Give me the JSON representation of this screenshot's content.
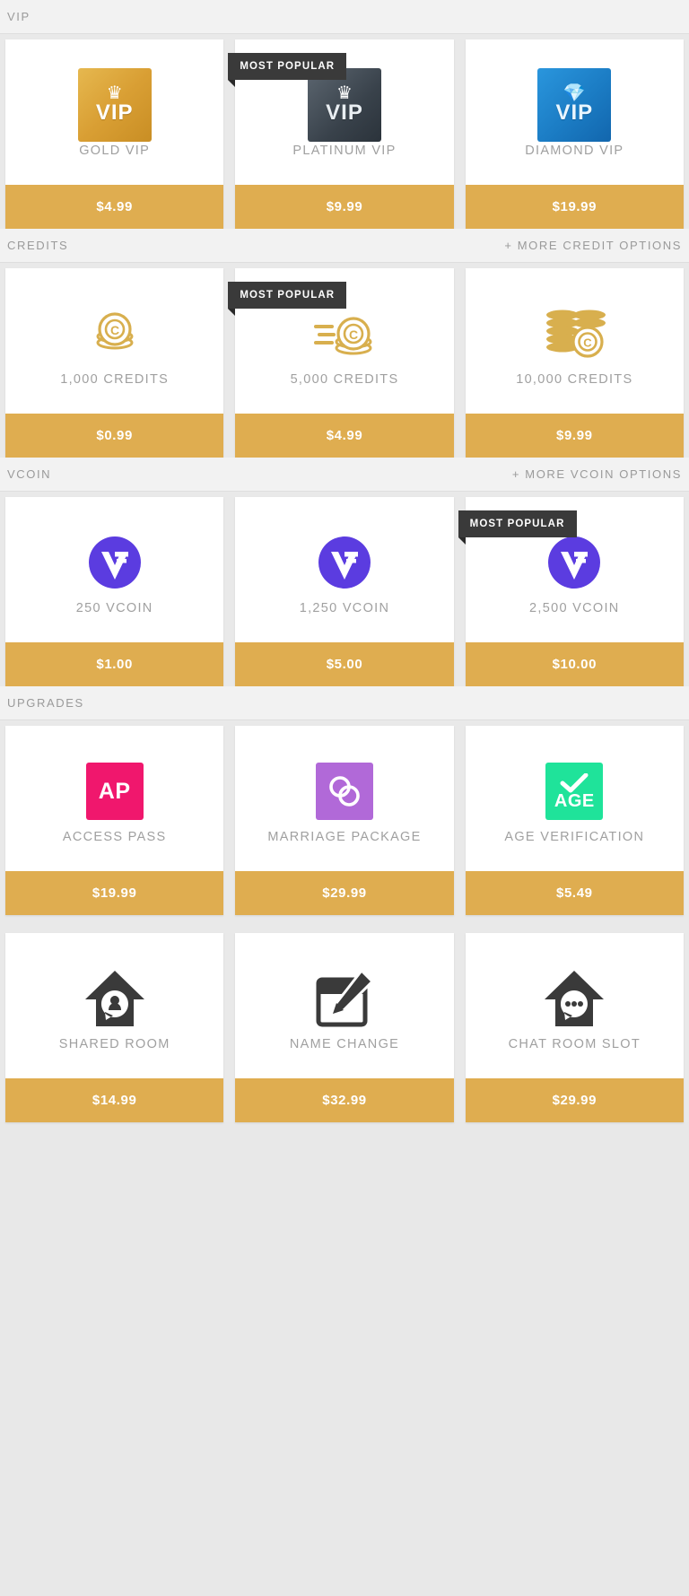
{
  "sections": [
    {
      "id": "vip",
      "title": "VIP",
      "more_label": "",
      "cards": [
        {
          "icon": "vip-gold-tile-icon",
          "label": "GOLD VIP",
          "price": "$4.99",
          "badge": ""
        },
        {
          "icon": "vip-platinum-tile-icon",
          "label": "PLATINUM VIP",
          "price": "$9.99",
          "badge": "MOST POPULAR"
        },
        {
          "icon": "vip-diamond-tile-icon",
          "label": "DIAMOND VIP",
          "price": "$19.99",
          "badge": ""
        }
      ]
    },
    {
      "id": "credits",
      "title": "CREDITS",
      "more_label": "+ MORE CREDIT OPTIONS",
      "cards": [
        {
          "icon": "single-coin-icon",
          "label": "1,000 CREDITS",
          "price": "$0.99",
          "badge": ""
        },
        {
          "icon": "flying-coin-icon",
          "label": "5,000 CREDITS",
          "price": "$4.99",
          "badge": "MOST POPULAR"
        },
        {
          "icon": "coin-stack-icon",
          "label": "10,000 CREDITS",
          "price": "$9.99",
          "badge": ""
        }
      ]
    },
    {
      "id": "vcoin",
      "title": "VCOIN",
      "more_label": "+ MORE VCOIN OPTIONS",
      "cards": [
        {
          "icon": "vcoin-icon",
          "label": "250 VCOIN",
          "price": "$1.00",
          "badge": ""
        },
        {
          "icon": "vcoin-icon",
          "label": "1,250 VCOIN",
          "price": "$5.00",
          "badge": ""
        },
        {
          "icon": "vcoin-icon",
          "label": "2,500 VCOIN",
          "price": "$10.00",
          "badge": "MOST POPULAR"
        }
      ]
    },
    {
      "id": "upgrades",
      "title": "UPGRADES",
      "more_label": "",
      "cards": [
        {
          "icon": "access-pass-icon",
          "label": "ACCESS PASS",
          "price": "$19.99",
          "badge": ""
        },
        {
          "icon": "marriage-rings-icon",
          "label": "MARRIAGE PACKAGE",
          "price": "$29.99",
          "badge": ""
        },
        {
          "icon": "age-verification-icon",
          "label": "AGE VERIFICATION",
          "price": "$5.49",
          "badge": ""
        }
      ]
    },
    {
      "id": "upgrades-2",
      "title": "",
      "more_label": "",
      "cards": [
        {
          "icon": "shared-room-house-icon",
          "label": "SHARED ROOM",
          "price": "$14.99",
          "badge": ""
        },
        {
          "icon": "name-change-pencil-icon",
          "label": "NAME CHANGE",
          "price": "$32.99",
          "badge": ""
        },
        {
          "icon": "chat-room-house-icon",
          "label": "CHAT ROOM SLOT",
          "price": "$29.99",
          "badge": ""
        }
      ]
    }
  ],
  "badges": {
    "most_popular": "MOST POPULAR"
  },
  "colors": {
    "price_button": "#dfad50",
    "badge_dark": "#3a3a3a",
    "gold": "#d99f34",
    "diamond_blue": "#1b7cc4",
    "vcoin_purple": "#5b3ce0",
    "access_pass_pink": "#f0176d",
    "marriage_purple": "#b169d8",
    "age_green": "#1fe39a",
    "label_grey": "#a0a0a0"
  },
  "icon_text": {
    "vip": "VIP",
    "access_pass": "AP",
    "age": "AGE",
    "credit_letter": "C"
  }
}
